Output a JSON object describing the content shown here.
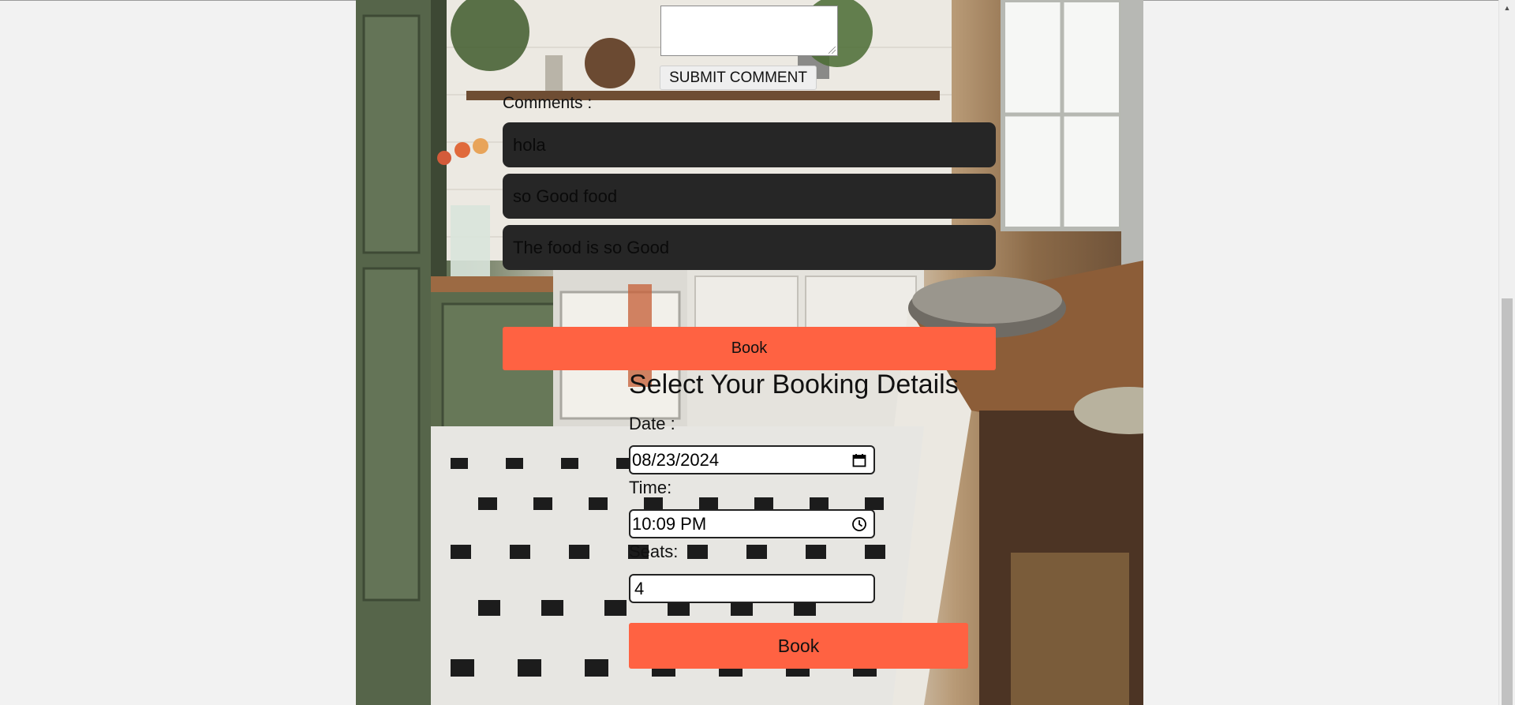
{
  "comment_form": {
    "comment_value": "",
    "submit_label": "SUBMIT COMMENT"
  },
  "comments": {
    "label": "Comments :",
    "items": [
      "hola",
      "so Good food",
      "The food is so Good"
    ]
  },
  "book_toggle_label": "Book",
  "booking": {
    "title": "Select Your Booking Details",
    "date_label": "Date :",
    "date_value": "08/23/2024",
    "time_label": "Time:",
    "time_value": "10:09 PM",
    "seats_label": "Seats:",
    "seats_value": "4",
    "submit_label": "Book"
  },
  "colors": {
    "accent": "#ff6242",
    "comment_bg": "#262626",
    "page_bg": "#f2f2f2"
  },
  "icons": [
    "calendar-icon",
    "clock-icon",
    "scroll-up-arrow-icon"
  ]
}
